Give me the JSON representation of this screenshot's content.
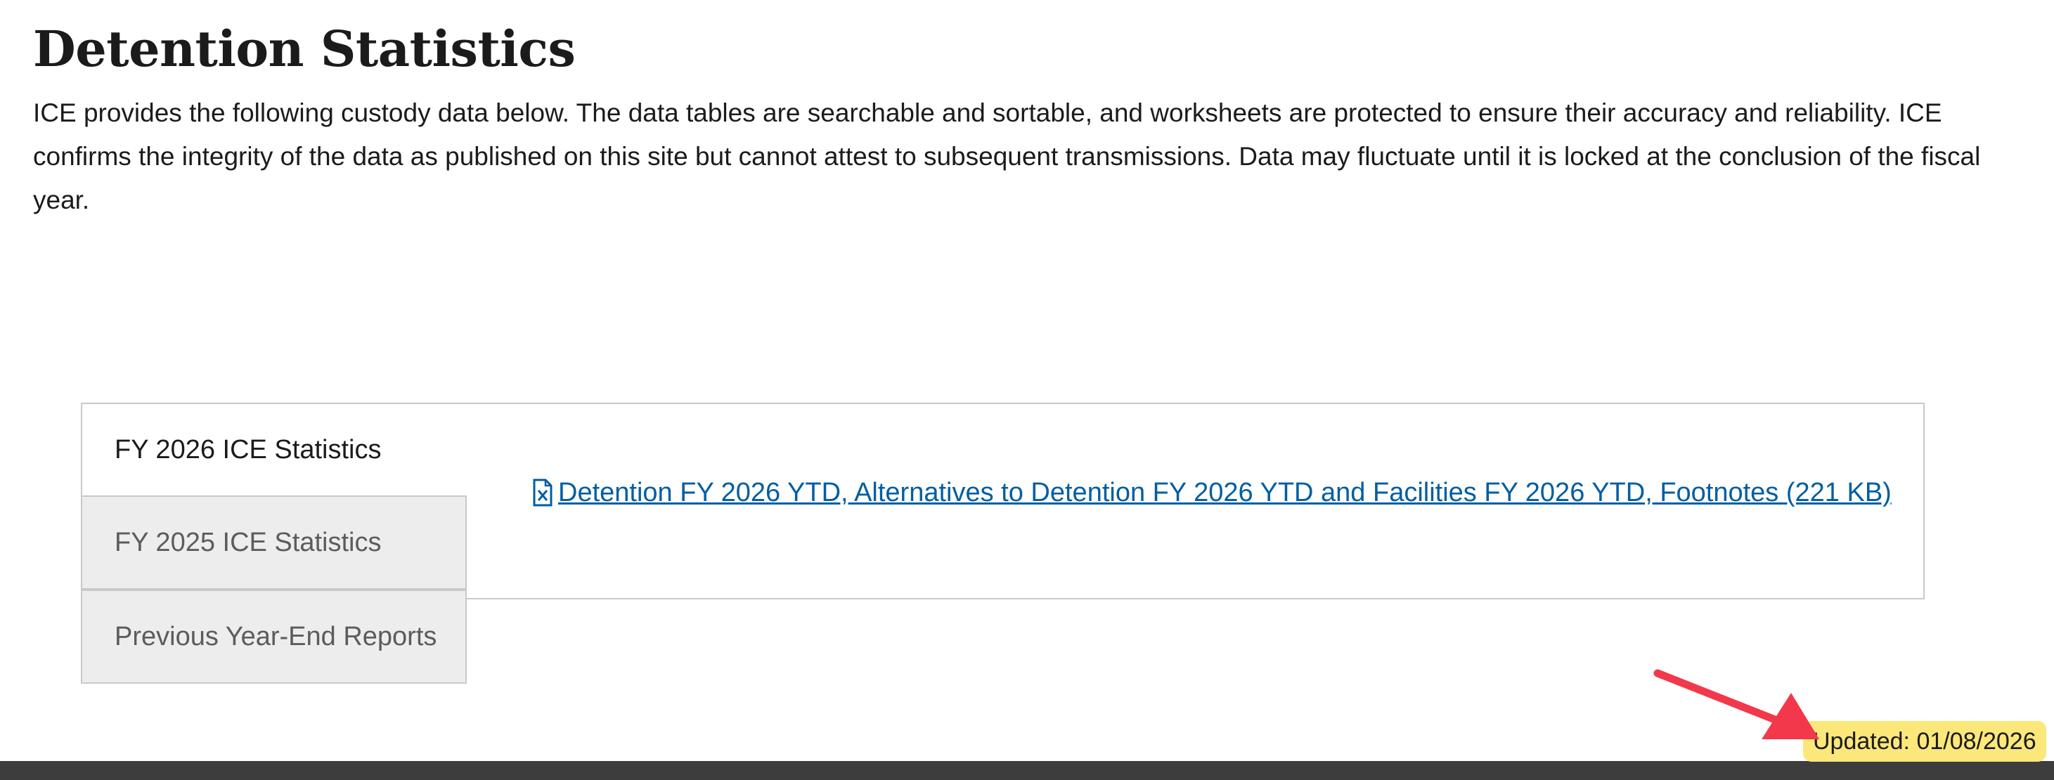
{
  "page": {
    "title": "Detention Statistics",
    "intro": "ICE provides the following custody data below. The data tables are searchable and sortable, and worksheets are protected to ensure their accuracy and reliability. ICE confirms the integrity of the data as published on this site but cannot attest to subsequent transmissions. Data may fluctuate until it is locked at the conclusion of the fiscal year."
  },
  "tabs": [
    {
      "label": "FY 2026 ICE Statistics",
      "active": true
    },
    {
      "label": "FY 2025 ICE Statistics",
      "active": false
    },
    {
      "label": "Previous Year-End Reports",
      "active": false
    }
  ],
  "panel": {
    "link_text": "Detention FY 2026 YTD, Alternatives to Detention FY 2026 YTD and Facilities FY 2026 YTD, Footnotes (221 KB)",
    "link_icon": "excel-file-icon"
  },
  "annotation": {
    "updated_label": "Updated: 01/08/2026",
    "arrow_color": "#f2384a",
    "highlight_color": "#fbe77a"
  },
  "colors": {
    "link": "#005ea2",
    "tab_inactive_bg": "#ededed",
    "footer": "#3d3d3d"
  }
}
